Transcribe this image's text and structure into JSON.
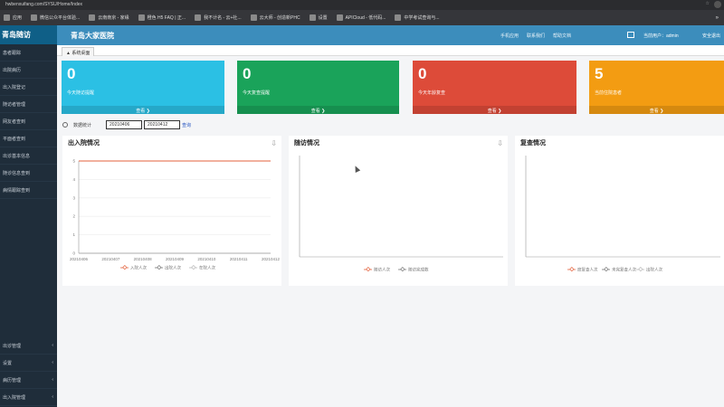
{
  "browser": {
    "url": "hwbenxuifang.com/SYSU/Home/Index",
    "bookmarks": [
      {
        "label": "应用"
      },
      {
        "label": "微信公众平台体验..."
      },
      {
        "label": "云南南京 - 家缘"
      },
      {
        "label": "橙色 H5 FAQ | 正..."
      },
      {
        "label": "我不计名 - 云+社..."
      },
      {
        "label": "云大师 - 创造新PHC"
      },
      {
        "label": "设置"
      },
      {
        "label": "APICloud - 低代码..."
      },
      {
        "label": "中学考试查询与..."
      }
    ]
  },
  "sidebar": {
    "brand": "青岛随访",
    "items": [
      "患者跟踪",
      "出院病历",
      "出入院登记",
      "随访者管理",
      "网友者查到",
      "平面者查到",
      "出诊基本信息",
      "随诊信息查到",
      "病情跟踪查到"
    ],
    "bottom": [
      "出诊管理",
      "设置",
      "病历管理",
      "出入院管理"
    ]
  },
  "topbar": {
    "hospital": "青岛大家医院",
    "links": [
      "手机应用",
      "联系我们",
      "帮助文档"
    ],
    "user": "当前用户：admin",
    "logout": "安全退出"
  },
  "tab": {
    "label": "系统桌面"
  },
  "cards": [
    {
      "number": "0",
      "label": "今天随访提醒",
      "footer": "查看 ❯",
      "color": "#2bc0e4"
    },
    {
      "number": "0",
      "label": "今天复查提醒",
      "footer": "查看 ❯",
      "color": "#1aa35a"
    },
    {
      "number": "0",
      "label": "今天年龄复查",
      "footer": "查看 ❯",
      "color": "#dd4b39"
    },
    {
      "number": "5",
      "label": "当前住院患者",
      "footer": "查看 ❯",
      "color": "#f39c12"
    }
  ],
  "filter": {
    "label": "数据统计",
    "start": "20210406",
    "end": "20210412",
    "query": "查询"
  },
  "panels": [
    {
      "title": "出入院情况"
    },
    {
      "title": "随访情况"
    },
    {
      "title": "复查情况"
    }
  ],
  "chart_data": [
    {
      "type": "line",
      "title": "出入院情况",
      "categories": [
        "20210406",
        "20210407",
        "20210408",
        "20210409",
        "20210410",
        "20210411",
        "20210412"
      ],
      "y_ticks": [
        "5",
        "4",
        "3",
        "2",
        "1",
        "0"
      ],
      "ylim": [
        0,
        5
      ],
      "series": [
        {
          "name": "入院人次",
          "values": [
            5,
            5,
            5,
            5,
            5,
            5,
            5
          ]
        },
        {
          "name": "出院人次",
          "values": [
            0,
            0,
            0,
            0,
            0,
            0,
            0
          ]
        },
        {
          "name": "在院人次",
          "values": [
            0,
            0,
            0,
            0,
            0,
            0,
            0
          ]
        }
      ],
      "legend": "bottom",
      "colors": [
        "#e3623d",
        "#777777",
        "#b9b9b9"
      ]
    },
    {
      "type": "line",
      "title": "随访情况",
      "categories": [],
      "series": [
        {
          "name": "随访人次",
          "values": []
        },
        {
          "name": "随访完成数",
          "values": []
        }
      ],
      "legend": "bottom",
      "colors": [
        "#e3623d",
        "#777777"
      ]
    },
    {
      "type": "line",
      "title": "复查情况",
      "categories": [],
      "series": [
        {
          "name": "度复查人次",
          "values": []
        },
        {
          "name": "未完复查人次",
          "values": []
        },
        {
          "name": "出院人次",
          "values": []
        }
      ],
      "legend": "bottom",
      "colors": [
        "#e3623d",
        "#777777",
        "#b9b9b9"
      ]
    }
  ]
}
